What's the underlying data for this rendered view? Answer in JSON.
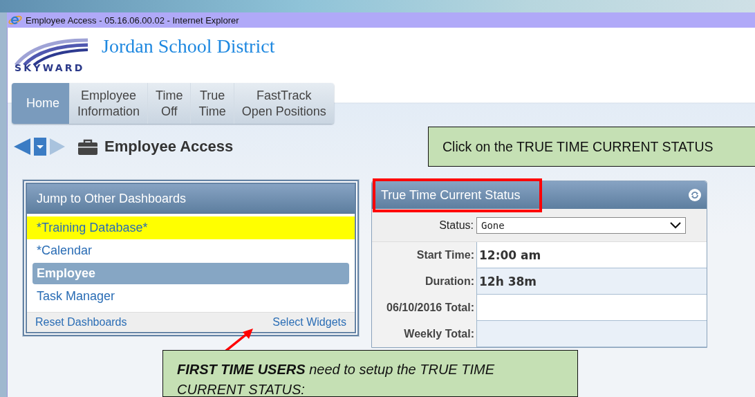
{
  "window": {
    "title": "Employee Access - 05.16.06.00.02 - Internet Explorer"
  },
  "header": {
    "logo_text": "SKYWARD",
    "district": "Jordan School District"
  },
  "tabs": [
    {
      "label": "Home",
      "selected": true
    },
    {
      "label": "Employee\nInformation",
      "selected": false
    },
    {
      "label": "Time\nOff",
      "selected": false
    },
    {
      "label": "True\nTime",
      "selected": false
    },
    {
      "label": "FastTrack\nOpen Positions",
      "selected": false
    }
  ],
  "page_title": "Employee Access",
  "dashboards": {
    "title": "Jump to Other Dashboards",
    "items": [
      {
        "label": "*Training Database*",
        "selected": false,
        "highlighted": true
      },
      {
        "label": "*Calendar",
        "selected": false,
        "highlighted": false
      },
      {
        "label": "Employee",
        "selected": true,
        "highlighted": false
      },
      {
        "label": "Task Manager",
        "selected": false,
        "highlighted": false
      }
    ],
    "footer_links": [
      "Reset Dashboards",
      "Select Widgets"
    ]
  },
  "status_panel": {
    "title": "True Time Current Status",
    "status_label": "Status:",
    "status_value": "Gone",
    "fields": [
      {
        "label": "Start Time:",
        "value": "12:00 am"
      },
      {
        "label": "Duration:",
        "value": "12h 38m"
      },
      {
        "label": "06/10/2016 Total:"
      },
      {
        "label": "Weekly Total:"
      }
    ]
  },
  "callouts": [
    {
      "kind": "plain",
      "text": "Click on the TRUE TIME CURRENT STATUS"
    },
    {
      "kind": "italic",
      "text": "**FIRST TIME USERS** need to setup the TRUE TIME CURRENT STATUS:"
    }
  ]
}
